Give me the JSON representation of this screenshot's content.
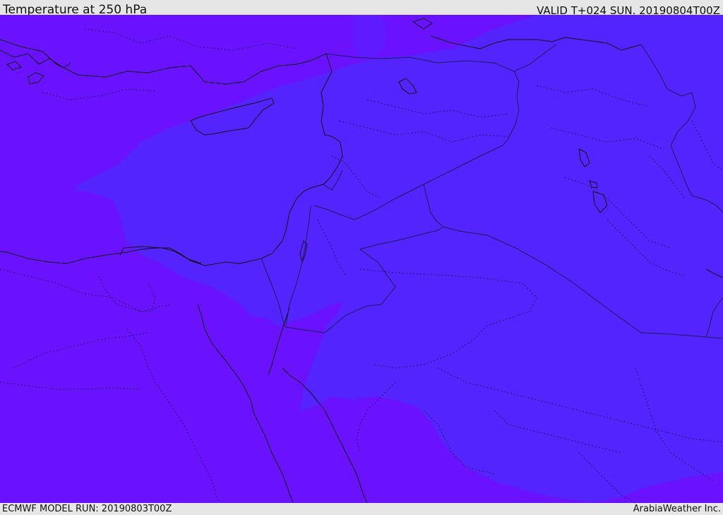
{
  "header": {
    "title": "Temperature at 250 hPa",
    "valid": "VALID T+024 SUN. 20190804T00Z"
  },
  "footer": {
    "model_run": "ECMWF MODEL RUN: 20190803T00Z",
    "brand": "ArabiaWeather Inc."
  },
  "map": {
    "field": "Temperature at 250 hPa",
    "colors": {
      "background": "#6a12fe",
      "warm_region": "#5324fd",
      "coastline": "#111111",
      "border": "#1b1b5a"
    }
  }
}
